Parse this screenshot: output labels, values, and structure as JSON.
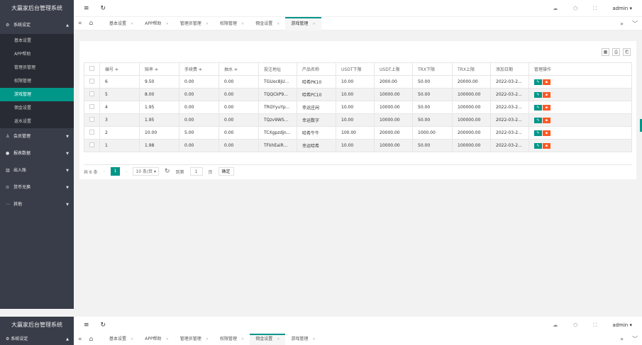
{
  "app_title": "大赢家后台管理系统",
  "sidebar": {
    "groups": [
      {
        "label": "系统设定",
        "icon": "gear-icon",
        "expanded": true,
        "items": [
          "基本设置",
          "APP帮助",
          "管理员管理",
          "权限管理",
          "游戏管理",
          "佣金设置",
          "返水设置"
        ],
        "active": "游戏管理"
      },
      {
        "label": "会员管理",
        "icon": "users-icon"
      },
      {
        "label": "报表数据",
        "icon": "chart-icon"
      },
      {
        "label": "出入账",
        "icon": "bank-icon"
      },
      {
        "label": "货币兑换",
        "icon": "exchange-icon"
      },
      {
        "label": "其他",
        "icon": "more-icon"
      }
    ]
  },
  "header": {
    "menu_icon": "≡",
    "refresh_icon": "↻",
    "user": "admin"
  },
  "tabs": {
    "items": [
      {
        "label": "基本设置"
      },
      {
        "label": "APP帮助"
      },
      {
        "label": "管理员管理"
      },
      {
        "label": "权限管理"
      },
      {
        "label": "佣金设置"
      },
      {
        "label": "游戏管理"
      }
    ],
    "active_index": 5
  },
  "table": {
    "headers": [
      "编号 ≑",
      "赔率 ≑",
      "手续费 ≑",
      "抽水 ≑",
      "投注地址",
      "产品名称",
      "USDT下限",
      "USDT上限",
      "TRX下限",
      "TRX上限",
      "添加日期",
      "管理操作"
    ],
    "rows": [
      [
        "6",
        "9.50",
        "0.00",
        "0.00",
        "TGUoc8jU...",
        "哈希PK10",
        "10.00",
        "2000.00",
        "50.00",
        "20000.00",
        "2022-03-2..."
      ],
      [
        "5",
        "8.00",
        "0.00",
        "0.00",
        "TQQCkP9...",
        "哈希PC10",
        "10.00",
        "10000.00",
        "50.00",
        "100000.00",
        "2022-03-2..."
      ],
      [
        "4",
        "1.95",
        "0.00",
        "0.00",
        "TRGYyuYp...",
        "幸运庄闲",
        "10.00",
        "10000.00",
        "50.00",
        "100000.00",
        "2022-03-2..."
      ],
      [
        "3",
        "1.95",
        "0.00",
        "0.00",
        "TQzv9WS...",
        "幸运数字",
        "10.00",
        "10000.00",
        "50.00",
        "100000.00",
        "2022-03-2..."
      ],
      [
        "2",
        "10.00",
        "5.00",
        "0.00",
        "TCXgpzdjn...",
        "哈希牛牛",
        "100.00",
        "20000.00",
        "1000.00",
        "200000.00",
        "2022-03-2..."
      ],
      [
        "1",
        "1.98",
        "0.00",
        "0.00",
        "TFkhEaiR...",
        "幸运哈希",
        "10.00",
        "10000.00",
        "50.00",
        "100000.00",
        "2022-03-2..."
      ]
    ]
  },
  "pager": {
    "total": "共 6 条",
    "current": "1",
    "per_page": "10 条/页",
    "goto": "到第",
    "goto_value": "1",
    "page_unit": "页",
    "confirm": "确定"
  },
  "bottom_tabs": {
    "items": [
      {
        "label": "基本设置"
      },
      {
        "label": "APP帮助"
      },
      {
        "label": "管理员管理"
      },
      {
        "label": "权限管理"
      },
      {
        "label": "佣金设置"
      },
      {
        "label": "游戏管理"
      }
    ],
    "active_index": 4
  },
  "colors": {
    "accent": "#009688",
    "danger": "#ff5722",
    "sidebar": "#393d49"
  }
}
